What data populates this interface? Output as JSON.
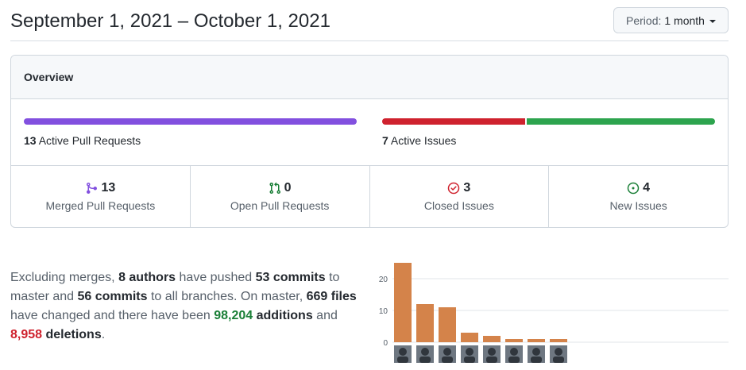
{
  "header": {
    "date_range": "September 1, 2021 – October 1, 2021",
    "period_label": "Period:",
    "period_value": "1 month"
  },
  "overview": {
    "title": "Overview",
    "pull_requests": {
      "count": "13",
      "label": "Active Pull Requests",
      "bar_color": "#8250df"
    },
    "issues": {
      "count": "7",
      "label": "Active Issues",
      "closed_fraction": 0.43,
      "closed_color": "#cf222e",
      "new_color": "#2da44e"
    },
    "stats": [
      {
        "value": "13",
        "label": "Merged Pull Requests",
        "icon": "merge-icon",
        "color": "#8250df"
      },
      {
        "value": "0",
        "label": "Open Pull Requests",
        "icon": "pull-request-icon",
        "color": "#1a7f37"
      },
      {
        "value": "3",
        "label": "Closed Issues",
        "icon": "issue-closed-icon",
        "color": "#cf222e"
      },
      {
        "value": "4",
        "label": "New Issues",
        "icon": "issue-opened-icon",
        "color": "#1a7f37"
      }
    ]
  },
  "summary": {
    "t1": "Excluding merges, ",
    "authors": "8 authors",
    "t2": " have pushed ",
    "commits_master": "53 commits",
    "t3": " to master and ",
    "commits_all": "56 commits",
    "t4": " to all branches. On master, ",
    "files": "669 files",
    "t5": " have changed and there have been ",
    "additions_num": "98,204",
    "additions_word": " additions",
    "t6": " and ",
    "deletions_num": "8,958",
    "deletions_word": " deletions",
    "t7": "."
  },
  "chart_data": {
    "type": "bar",
    "categories": [
      "author-1",
      "author-2",
      "author-3",
      "author-4",
      "author-5",
      "author-6",
      "author-7",
      "author-8"
    ],
    "values": [
      25,
      12,
      11,
      3,
      2,
      1,
      1,
      1
    ],
    "yticks": [
      "0",
      "10",
      "20"
    ],
    "ylim": [
      0,
      26
    ],
    "bar_color": "#d4834a",
    "grid": true
  }
}
